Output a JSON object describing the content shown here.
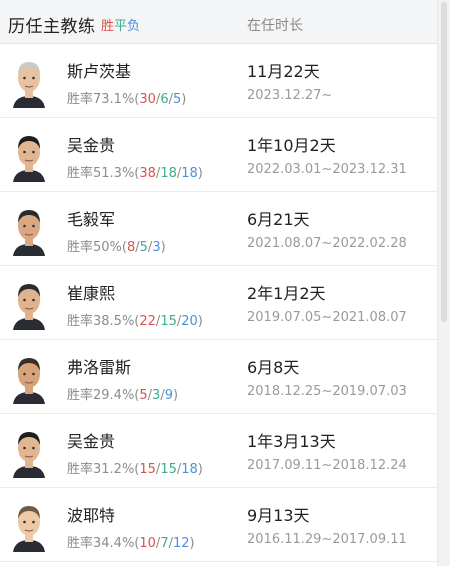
{
  "header": {
    "title": "历任主教练",
    "legend_win": "胜",
    "legend_draw": "平",
    "legend_loss": "负",
    "col_tenure": "在任时长"
  },
  "colors": {
    "win": "#d9534f",
    "draw": "#3cae8c",
    "loss": "#4a90d9"
  },
  "coaches": [
    {
      "name": "斯卢茨基",
      "rate_label": "胜率73.1%(",
      "w": "30",
      "d": "6",
      "l": "5",
      "tenure": "11月22天",
      "period": "2023.12.27~",
      "avatar": "coach-portrait-1"
    },
    {
      "name": "吴金贵",
      "rate_label": "胜率51.3%(",
      "w": "38",
      "d": "18",
      "l": "18",
      "tenure": "1年10月2天",
      "period": "2022.03.01~2023.12.31",
      "avatar": "coach-portrait-2"
    },
    {
      "name": "毛毅军",
      "rate_label": "胜率50%(",
      "w": "8",
      "d": "5",
      "l": "3",
      "tenure": "6月21天",
      "period": "2021.08.07~2022.02.28",
      "avatar": "coach-portrait-3"
    },
    {
      "name": "崔康熙",
      "rate_label": "胜率38.5%(",
      "w": "22",
      "d": "15",
      "l": "20",
      "tenure": "2年1月2天",
      "period": "2019.07.05~2021.08.07",
      "avatar": "coach-portrait-4"
    },
    {
      "name": "弗洛雷斯",
      "rate_label": "胜率29.4%(",
      "w": "5",
      "d": "3",
      "l": "9",
      "tenure": "6月8天",
      "period": "2018.12.25~2019.07.03",
      "avatar": "coach-portrait-5"
    },
    {
      "name": "吴金贵",
      "rate_label": "胜率31.2%(",
      "w": "15",
      "d": "15",
      "l": "18",
      "tenure": "1年3月13天",
      "period": "2017.09.11~2018.12.24",
      "avatar": "coach-portrait-6"
    },
    {
      "name": "波耶特",
      "rate_label": "胜率34.4%(",
      "w": "10",
      "d": "7",
      "l": "12",
      "tenure": "9月13天",
      "period": "2016.11.29~2017.09.11",
      "avatar": "coach-portrait-7"
    }
  ]
}
